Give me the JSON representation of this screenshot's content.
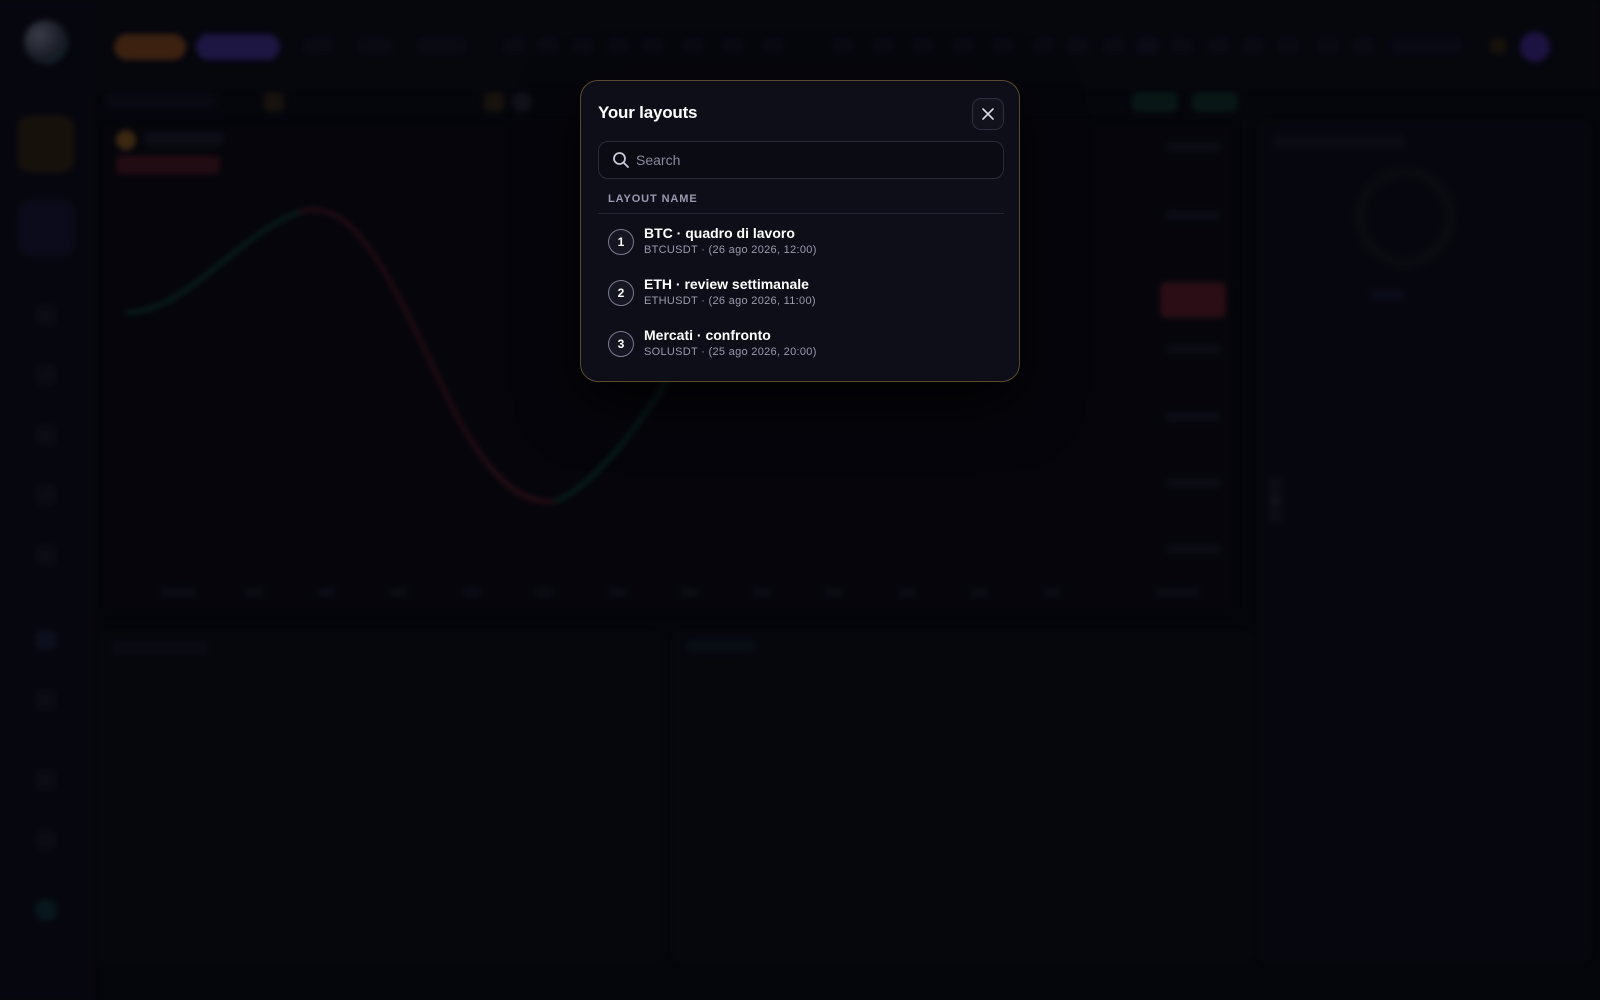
{
  "modal": {
    "title": "Your layouts",
    "search_placeholder": "Search",
    "column_header": "LAYOUT NAME",
    "layouts": [
      {
        "index": "1",
        "name": "BTC · quadro di lavoro",
        "meta": "BTCUSDT · (26 ago 2026, 12:00)"
      },
      {
        "index": "2",
        "name": "ETH · review settimanale",
        "meta": "ETHUSDT · (26 ago 2026, 11:00)"
      },
      {
        "index": "3",
        "name": "Mercati · confronto",
        "meta": "SOLUSDT · (25 ago 2026, 20:00)"
      }
    ]
  },
  "colors": {
    "modal_border": "#5a4a2c",
    "accent_orange": "#f08a2c",
    "accent_purple": "#6b4ce6",
    "up_green": "#1f8a66",
    "down_red": "#b8323c"
  },
  "background": {
    "collapse_glyph": "›"
  }
}
